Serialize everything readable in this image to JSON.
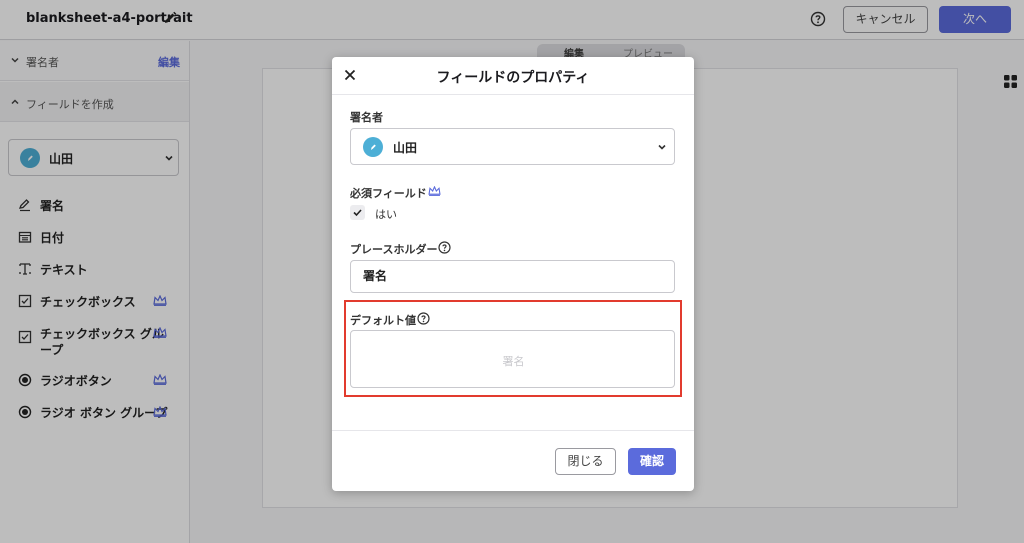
{
  "header": {
    "title": "blanksheet-a4-portrait",
    "cancel_label": "キャンセル",
    "next_label": "次へ"
  },
  "sidebar": {
    "signer_section_label": "署名者",
    "edit_label": "編集",
    "create_field_label": "フィールドを作成",
    "signer_selected": "山田",
    "tools": [
      {
        "label": "署名",
        "icon": "signature-icon",
        "premium": false
      },
      {
        "label": "日付",
        "icon": "calendar-icon",
        "premium": false
      },
      {
        "label": "テキスト",
        "icon": "text-icon",
        "premium": false
      },
      {
        "label": "チェックボックス",
        "icon": "checkbox-icon",
        "premium": true
      },
      {
        "label": "チェックボックス グループ",
        "icon": "checkbox-group-icon",
        "premium": true
      },
      {
        "label": "ラジオボタン",
        "icon": "radio-icon",
        "premium": true
      },
      {
        "label": "ラジオ ボタン グループ",
        "icon": "radio-group-icon",
        "premium": true
      }
    ]
  },
  "canvas": {
    "tab_edit": "編集",
    "tab_preview": "プレビュー"
  },
  "modal": {
    "title": "フィールドのプロパティ",
    "signer_label": "署名者",
    "signer_value": "山田",
    "required_label": "必須フィールド",
    "required_option": "はい",
    "placeholder_label": "プレースホルダー",
    "placeholder_value": "署名",
    "default_label": "デフォルト値",
    "default_placeholder": "署名",
    "close_label": "閉じる",
    "confirm_label": "確認"
  },
  "colors": {
    "accent": "#5b6bdc",
    "avatar": "#4dafd6",
    "highlight": "#e23b2e"
  }
}
